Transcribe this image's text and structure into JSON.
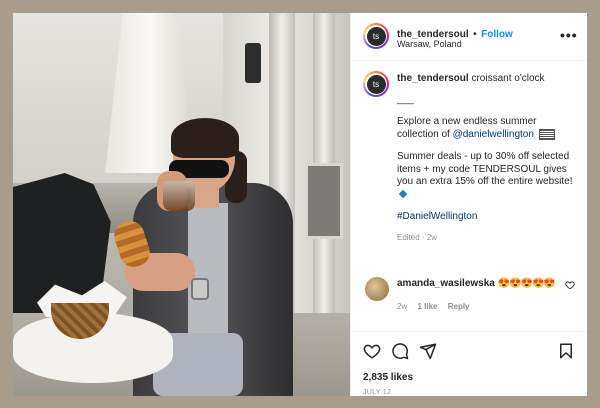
{
  "post": {
    "username": "the_tendersoul",
    "separator": "•",
    "follow_label": "Follow",
    "location": "Warsaw, Poland",
    "more_label": "•••",
    "avatar_initial": "ts"
  },
  "caption": {
    "username": "the_tendersoul",
    "first_line": "croissant o'clock",
    "divider": "___",
    "paragraph1_text": "Explore a new endless summer collection of ",
    "paragraph1_mention": "@danielwellington",
    "paragraph2": "Summer deals - up to 30% off selected items + my code TENDERSOUL gives you an extra 15% off the entire website!",
    "hashtag": "#DanielWellington",
    "edited": "Edited",
    "dot": "·",
    "age": "2w"
  },
  "comment": {
    "username": "amanda_wasilewska",
    "emojis": "😍😍😍😍😍",
    "age": "2w",
    "likes": "1 like",
    "reply_label": "Reply"
  },
  "footer": {
    "likes": "2,835 likes",
    "date": "JULY 12"
  },
  "icons": [
    "more-options-icon",
    "heart-icon",
    "comment-icon",
    "share-icon",
    "bookmark-icon",
    "flag-icon",
    "verified-diamond-icon"
  ],
  "colors": {
    "accent": "#0095f6",
    "hashtag": "#00376b",
    "muted": "#8e8e8e",
    "background": "#a99c8d"
  }
}
